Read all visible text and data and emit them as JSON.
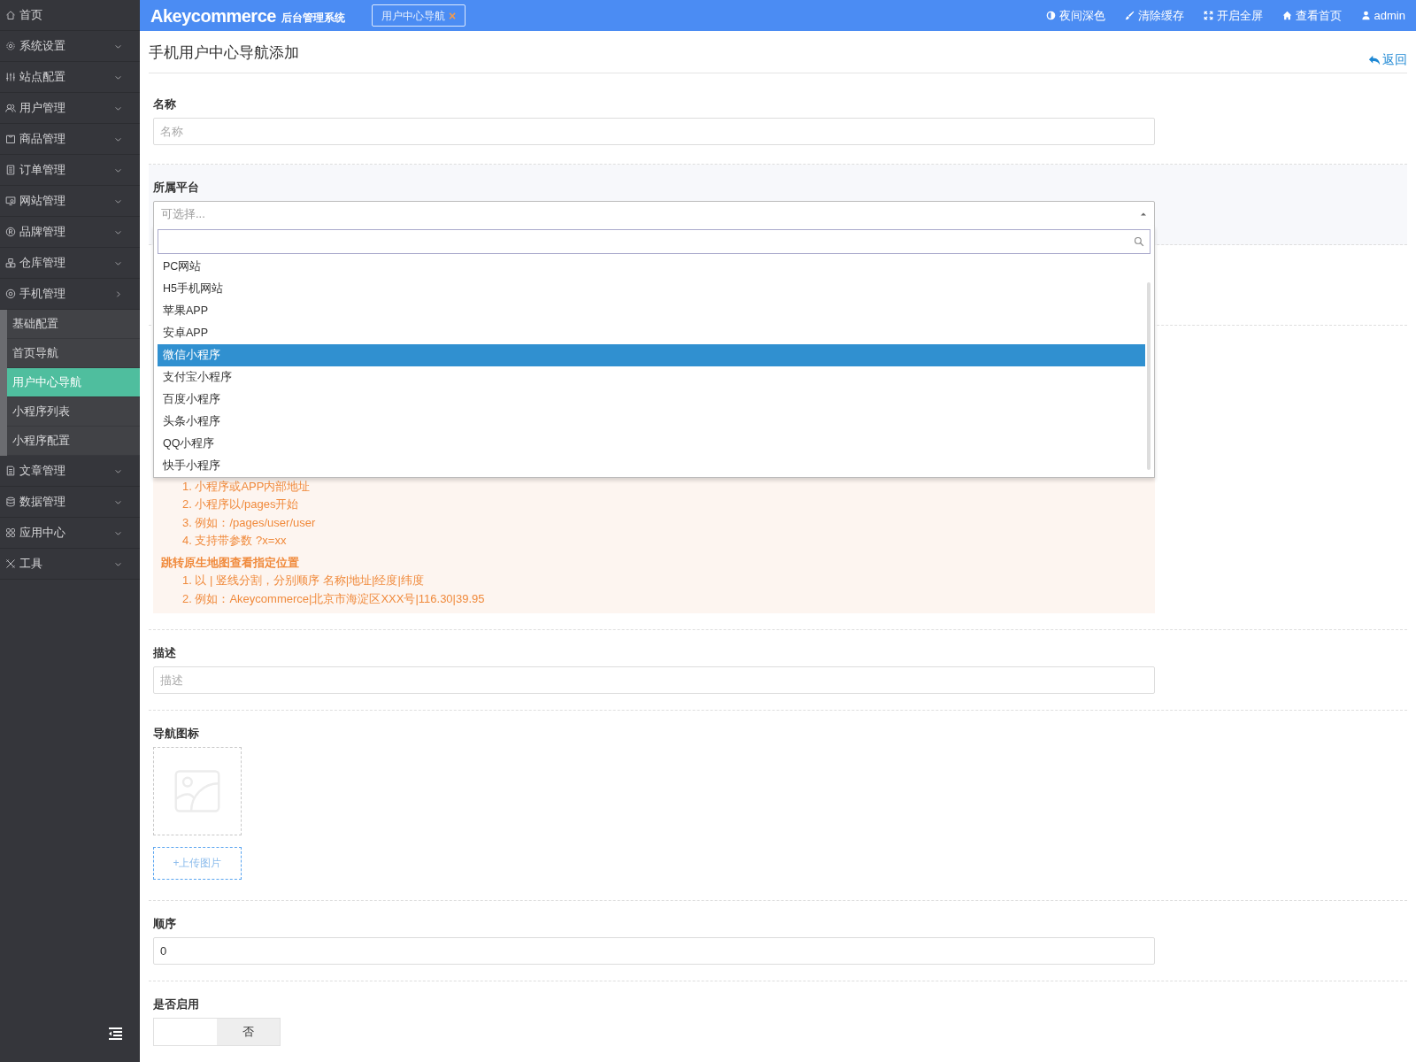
{
  "sidebar": {
    "items": [
      {
        "label": "首页",
        "has_menu": false
      },
      {
        "label": "系统设置",
        "has_menu": true,
        "expanded": false
      },
      {
        "label": "站点配置",
        "has_menu": true,
        "expanded": false
      },
      {
        "label": "用户管理",
        "has_menu": true,
        "expanded": false
      },
      {
        "label": "商品管理",
        "has_menu": true,
        "expanded": false
      },
      {
        "label": "订单管理",
        "has_menu": true,
        "expanded": false
      },
      {
        "label": "网站管理",
        "has_menu": true,
        "expanded": false
      },
      {
        "label": "品牌管理",
        "has_menu": true,
        "expanded": false
      },
      {
        "label": "仓库管理",
        "has_menu": true,
        "expanded": false
      },
      {
        "label": "手机管理",
        "has_menu": true,
        "expanded": true,
        "children": [
          {
            "label": "基础配置",
            "selected": false
          },
          {
            "label": "首页导航",
            "selected": false
          },
          {
            "label": "用户中心导航",
            "selected": true
          },
          {
            "label": "小程序列表",
            "selected": false
          },
          {
            "label": "小程序配置",
            "selected": false
          }
        ]
      },
      {
        "label": "文章管理",
        "has_menu": true,
        "expanded": false
      },
      {
        "label": "数据管理",
        "has_menu": true,
        "expanded": false
      },
      {
        "label": "应用中心",
        "has_menu": true,
        "expanded": false
      },
      {
        "label": "工具",
        "has_menu": true,
        "expanded": false
      }
    ]
  },
  "header": {
    "logo": "Akeycommerce",
    "logo_sub": "后台管理系统",
    "open_tab": {
      "label": "用户中心导航",
      "close": "×"
    },
    "actions": [
      {
        "label": "夜间深色"
      },
      {
        "label": "清除缓存"
      },
      {
        "label": "开启全屏"
      },
      {
        "label": "查看首页"
      },
      {
        "label": "admin"
      }
    ]
  },
  "page": {
    "title": "手机用户中心导航添加",
    "back": "返回"
  },
  "form": {
    "name": {
      "label": "名称",
      "placeholder": "名称"
    },
    "platform": {
      "label": "所属平台",
      "placeholder": "可选择...",
      "open": true,
      "options": [
        {
          "label": "PC网站",
          "selected": false
        },
        {
          "label": "H5手机网站",
          "selected": false
        },
        {
          "label": "苹果APP",
          "selected": false
        },
        {
          "label": "安卓APP",
          "selected": false
        },
        {
          "label": "微信小程序",
          "selected": true
        },
        {
          "label": "支付宝小程序",
          "selected": false
        },
        {
          "label": "百度小程序",
          "selected": false
        },
        {
          "label": "头条小程序",
          "selected": false
        },
        {
          "label": "QQ小程序",
          "selected": false
        },
        {
          "label": "快手小程序",
          "selected": false
        }
      ]
    },
    "notes": [
      {
        "items": [
          "1. 小程序或APP内部地址",
          "2. 小程序以/pages开始",
          "3. 例如：/pages/user/user",
          "4. 支持带参数 ?x=xx"
        ]
      },
      {
        "heading": "跳转原生地图查看指定位置",
        "items": [
          "1. 以 | 竖线分割，分别顺序 名称|地址|经度|纬度",
          "2. 例如：Akeycommerce|北京市海淀区XXX号|116.30|39.95"
        ]
      }
    ],
    "description": {
      "label": "描述",
      "placeholder": "描述"
    },
    "icon": {
      "label": "导航图标",
      "upload": "+上传图片"
    },
    "order": {
      "label": "顺序",
      "value": "0"
    },
    "enabled": {
      "label": "是否启用",
      "off_label": "否",
      "on": false
    }
  }
}
